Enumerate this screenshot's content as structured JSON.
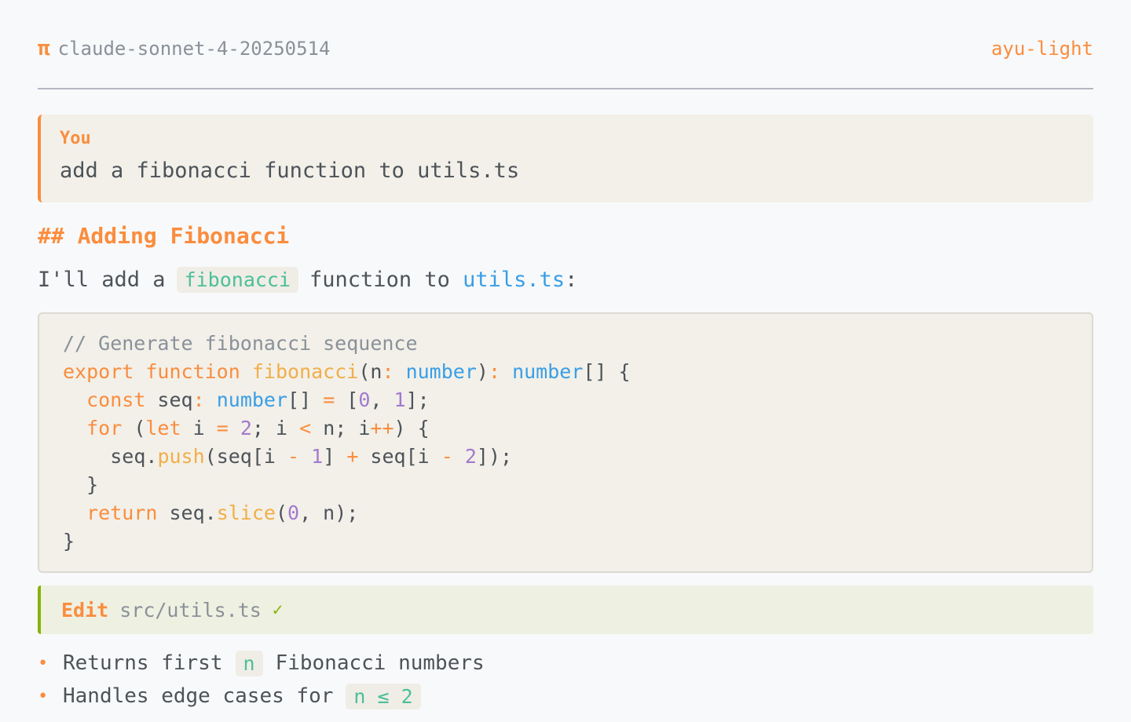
{
  "header": {
    "model": "claude-sonnet-4-20250514",
    "theme": "ayu-light",
    "icon": "pi-icon"
  },
  "user_message": {
    "label": "You",
    "text": "add a fibonacci function to utils.ts"
  },
  "response": {
    "heading": "## Adding Fibonacci",
    "intro_before": "I'll add a",
    "intro_code": "fibonacci",
    "intro_middle": "function to ",
    "intro_link": "utils.ts",
    "intro_after": ":"
  },
  "code": {
    "comment": "// Generate fibonacci sequence",
    "l2_export": "export",
    "l2_function": "function",
    "l2_name": "fibonacci",
    "l2_open": "(n",
    "l2_colon": ":",
    "l2_type": "number",
    "l2_close": ")",
    "l2_colon2": ":",
    "l2_rtype": "number",
    "l2_tail": "[] {",
    "l3_const": "const",
    "l3_var": " seq",
    "l3_colon": ":",
    "l3_type": "number",
    "l3_mid": "[] ",
    "l3_eq": "=",
    "l3_open": " [",
    "l3_n0": "0",
    "l3_comma": ", ",
    "l3_n1": "1",
    "l3_close": "];",
    "l4_for": "for",
    "l4_open": " (",
    "l4_let": "let",
    "l4_i": " i ",
    "l4_eq": "=",
    "l4_n2": "2",
    "l4_mid": "; i ",
    "l4_lt": "<",
    "l4_mid2": " n; i",
    "l4_inc": "++",
    "l4_close": ") {",
    "l5_seq": "seq.",
    "l5_push": "push",
    "l5_a": "(seq[i ",
    "l5_minus": "-",
    "l5_n1": "1",
    "l5_b": "] ",
    "l5_plus": "+",
    "l5_c": " seq[i ",
    "l5_minus2": "-",
    "l5_n2": "2",
    "l5_d": "]);",
    "l6": "}",
    "l7_return": "return",
    "l7_seq": " seq.",
    "l7_slice": "slice",
    "l7_open": "(",
    "l7_n0": "0",
    "l7_close": ", n);",
    "l8": "}"
  },
  "tool": {
    "name": "Edit",
    "path": "src/utils.ts",
    "status": "✓"
  },
  "bullets": [
    {
      "before": "Returns first",
      "code": "n",
      "after": "Fibonacci numbers"
    },
    {
      "before": "Handles edge cases for",
      "code": "n ≤ 2",
      "after": ""
    }
  ],
  "colors": {
    "accent": "#fa8d3e",
    "success": "#86b300",
    "link": "#399ee6",
    "inline_code": "#4cbf99"
  }
}
